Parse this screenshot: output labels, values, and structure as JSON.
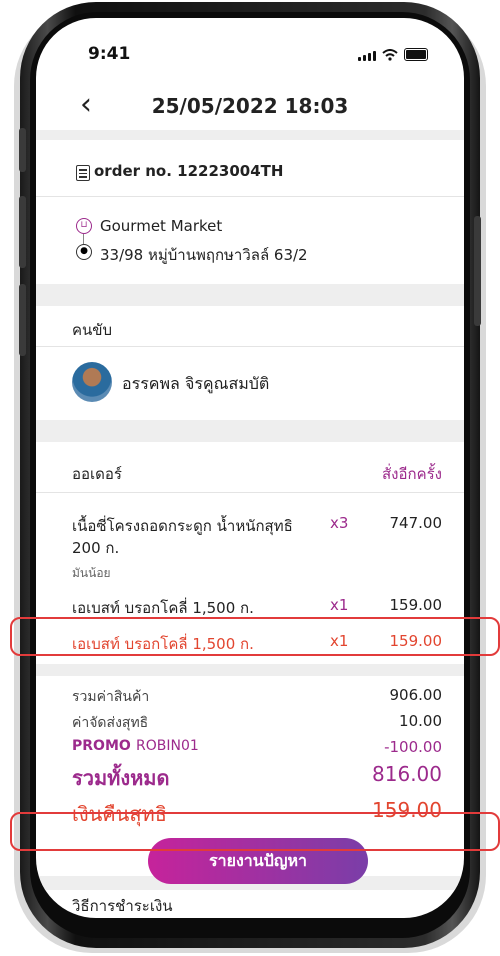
{
  "status_bar": {
    "time": "9:41"
  },
  "header": {
    "back_label": "‹",
    "title": "25/05/2022 18:03"
  },
  "order": {
    "number_label": "order no. 12223004TH"
  },
  "route": {
    "store": "Gourmet Market",
    "address": "33/98 หมู่บ้านพฤกษาวิลล์ 63/2"
  },
  "driver": {
    "section_title": "คนขับ",
    "name": "อรรคพล จิรคูณสมบัติ"
  },
  "order_section": {
    "title": "ออเดอร์",
    "reorder_label": "สั่งอีกครั้ง"
  },
  "items": [
    {
      "name_line1": "เนื้อซี่โครงถอดกระดูก น้ำหนักสุทธิ",
      "name_line2": "200 ก.",
      "note": "มันน้อย",
      "qty": "x3",
      "price": "747.00"
    },
    {
      "name": "เอเบสท์ บรอกโคลี่ 1,500 ก.",
      "qty": "x1",
      "price": "159.00"
    },
    {
      "name": "เอเบสท์ บรอกโคลี่ 1,500 ก.",
      "qty": "x1",
      "price": "159.00"
    }
  ],
  "summary": {
    "subtotal_label": "รวมค่าสินค้า",
    "subtotal": "906.00",
    "delivery_label": "ค่าจัดส่งสุทธิ",
    "delivery": "10.00",
    "promo_label": "PROMO",
    "promo_code": "ROBIN01",
    "promo_value": "-100.00",
    "total_label": "รวมทั้งหมด",
    "total": "816.00",
    "refund_label": "เงินคืนสุทธิ",
    "refund": "159.00"
  },
  "report_button": "รายงานปัญหา",
  "payment_section": {
    "title": "วิธีการชำระเงิน"
  },
  "colors": {
    "accent": "#9c2a8c",
    "refund": "#e2452f",
    "button_start": "#c6239b",
    "button_end": "#7a3ea8"
  }
}
